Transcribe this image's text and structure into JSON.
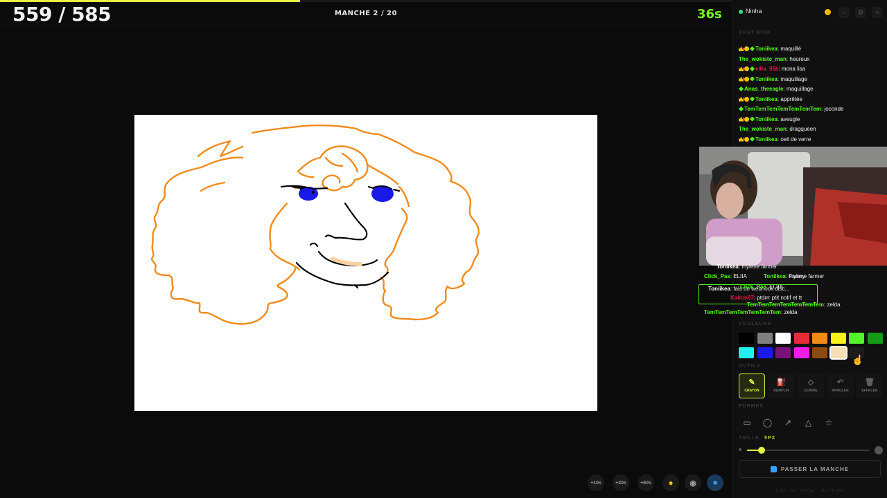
{
  "game": {
    "score": "559 / 585",
    "round": "MANCHE 2 / 20",
    "timer": "36s",
    "round_progress_fraction": 0.41
  },
  "bottom_tools": [
    "+10s",
    "+20s",
    "+60s"
  ],
  "panel": {
    "streamer": "Ninha",
    "chat_label": "CHAT KICK",
    "chat": [
      {
        "badges": [
          "crown",
          "coin",
          "gem"
        ],
        "user": "Toniikea",
        "user_color": "#53fc18",
        "text": "maquillé"
      },
      {
        "badges": [],
        "user": "The_wokiste_man",
        "user_color": "#53fc18",
        "text": "heureux"
      },
      {
        "badges": [
          "crown",
          "coin",
          "gem"
        ],
        "user": "ellia_95k",
        "user_color": "#e8174b",
        "text": "mona lisa"
      },
      {
        "badges": [
          "crown",
          "coin",
          "gem"
        ],
        "user": "Toniikea",
        "user_color": "#53fc18",
        "text": "maquillage"
      },
      {
        "badges": [
          "gem"
        ],
        "user": "Anas_theeagle",
        "user_color": "#53fc18",
        "text": "maquillage"
      },
      {
        "badges": [
          "crown",
          "coin",
          "gem"
        ],
        "user": "Toniikea",
        "user_color": "#53fc18",
        "text": "apprêtée"
      },
      {
        "badges": [
          "gem"
        ],
        "user": "TemTemTemTemTemTemTem",
        "user_color": "#53fc18",
        "text": "joconde"
      },
      {
        "badges": [
          "crown",
          "coin",
          "gem"
        ],
        "user": "Toniikea",
        "user_color": "#53fc18",
        "text": "aveugle"
      },
      {
        "badges": [],
        "user": "The_wokiste_man",
        "user_color": "#53fc18",
        "text": "dragqueen"
      },
      {
        "badges": [
          "crown",
          "coin",
          "gem"
        ],
        "user": "Toniikea",
        "user_color": "#53fc18",
        "text": "oeil de verre"
      }
    ],
    "overlay_chat": [
      {
        "user": "Toniikea",
        "text": "mylene farmer",
        "user_color": "#ffffff"
      },
      {
        "user": "Fanny",
        "text": "",
        "user_color": "#bbbbbb"
      },
      {
        "user": "Click_Pas",
        "text": "ELIIA",
        "user_color": "#53fc18"
      },
      {
        "user": "Toniikea",
        "text": "mylene farmer",
        "user_color": "#53fc18"
      },
      {
        "user": "Toniikea",
        "text": "fais un webhook disc...",
        "user_color": "#ffffff"
      },
      {
        "user": "Click_Pas",
        "text": "ELIIA",
        "user_color": "#53fc18"
      },
      {
        "user": "Kaiton07",
        "text": "ptdrrr ptit notif et tt",
        "user_color": "#e8174b"
      },
      {
        "user": "TemTemTemTemTemTemTem",
        "text": "zelda",
        "user_color": "#53fc18"
      },
      {
        "user": "TemTemTemTemTemTemTem",
        "text": "zelda",
        "user_color": "#53fc18"
      }
    ],
    "colors_label": "COULEURS",
    "colors": [
      "#000000",
      "#808080",
      "#ffffff",
      "#e52d3a",
      "#f28a1a",
      "#f5f21a",
      "#54f42d",
      "#159a17",
      "#1ff0f0",
      "#1a1ae8",
      "#7a117a",
      "#f01de4",
      "#8b4a12",
      "#f6e1b4",
      "#1c1c1c"
    ],
    "selected_color_index": 13,
    "tools_label": "OUTILS",
    "tools": [
      {
        "label": "CRAYON",
        "icon": "pencil-icon",
        "glyph": "✎",
        "active": true
      },
      {
        "label": "REMPLIR",
        "icon": "fill-icon",
        "glyph": "⛽",
        "active": false
      },
      {
        "label": "GOMME",
        "icon": "eraser-icon",
        "glyph": "◇",
        "active": false
      },
      {
        "label": "ANNULER",
        "icon": "undo-icon",
        "glyph": "↶",
        "active": false
      },
      {
        "label": "EFFACER",
        "icon": "trash-icon",
        "glyph": "🗑",
        "active": false
      }
    ],
    "shapes_label": "FORMES",
    "shapes": [
      {
        "icon": "rectangle-icon",
        "glyph": "▭"
      },
      {
        "icon": "ellipse-icon",
        "glyph": "◯"
      },
      {
        "icon": "arrow-icon",
        "glyph": "↗"
      },
      {
        "icon": "triangle-icon",
        "glyph": "△"
      },
      {
        "icon": "star-icon",
        "glyph": "☆"
      }
    ],
    "size_label": "TAILLE",
    "size_value": "5PX",
    "size_fraction": 0.12,
    "skip_button": "PASSER LA MANCHE",
    "footer": "built for ninha · by leido"
  }
}
